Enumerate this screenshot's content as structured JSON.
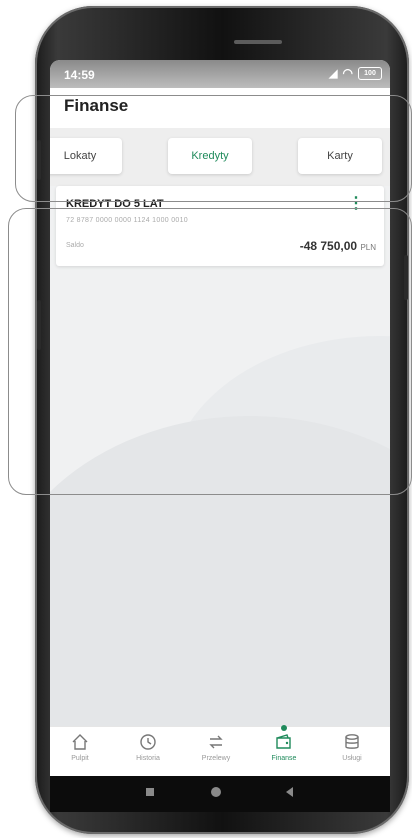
{
  "status": {
    "time": "14:59",
    "battery": "100"
  },
  "header": {
    "title": "Finanse"
  },
  "tabs": [
    {
      "label": "Lokaty"
    },
    {
      "label": "Kredyty"
    },
    {
      "label": "Karty"
    }
  ],
  "active_tab": "Kredyty",
  "card": {
    "title": "KREDYT DO 5 LAT",
    "account": "72 8787 0000 0000 1124 1000 0010",
    "saldo_label": "Saldo",
    "saldo_value": "-48 750,00",
    "currency": "PLN"
  },
  "bottom_nav": [
    {
      "label": "Pulpit",
      "icon": "home-icon"
    },
    {
      "label": "Historia",
      "icon": "history-icon"
    },
    {
      "label": "Przelewy",
      "icon": "transfer-icon"
    },
    {
      "label": "Finanse",
      "icon": "finance-icon"
    },
    {
      "label": "Usługi",
      "icon": "services-icon"
    }
  ],
  "active_nav": "Finanse",
  "colors": {
    "accent": "#1f8a5b"
  }
}
